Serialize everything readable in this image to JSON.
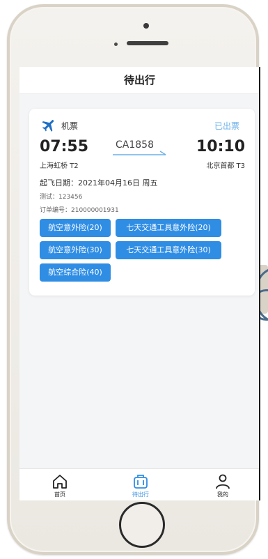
{
  "header": {
    "title": "待出行"
  },
  "ticket": {
    "type_label": "机票",
    "status": "已出票",
    "departure_time": "07:55",
    "departure_airport": "上海虹桥 T2",
    "flight_number": "CA1858",
    "arrival_time": "10:10",
    "arrival_airport": "北京首都 T3",
    "date_line": "起飞日期：2021年04月16日 周五",
    "extra_line": "测试：123456",
    "order_line": "订单编号：210000001931",
    "insurance": [
      "航空意外险(20)",
      "七天交通工具意外险(20)",
      "航空意外险(30)",
      "七天交通工具意外险(30)",
      "航空综合险(40)"
    ]
  },
  "tabs": [
    {
      "label": "首页",
      "icon": "home-icon",
      "active": false
    },
    {
      "label": "待出行",
      "icon": "luggage-icon",
      "active": true
    },
    {
      "label": "我的",
      "icon": "user-icon",
      "active": false
    }
  ],
  "colors": {
    "accent": "#2f8de4",
    "status": "#6ab0ea",
    "background": "#f4f5f7"
  }
}
